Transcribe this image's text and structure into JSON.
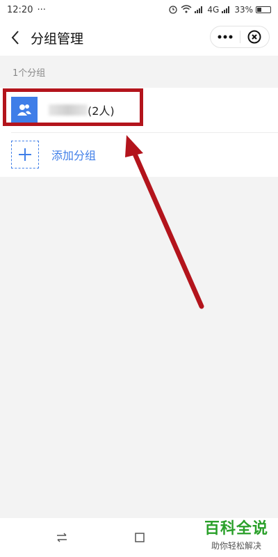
{
  "status_bar": {
    "time": "12:20",
    "overflow": "···",
    "network": "4G",
    "battery": "33%"
  },
  "header": {
    "title": "分组管理",
    "more_icon": "more-dots-icon",
    "close_icon": "close-circle-icon"
  },
  "groups_section": {
    "count_label": "1个分组"
  },
  "group_item": {
    "member_count": "(2人)",
    "icon": "group-people-icon"
  },
  "add_group": {
    "label": "添加分组",
    "icon": "plus-icon"
  },
  "watermark": {
    "title": "百科全说",
    "subtitle": "助你轻松解决"
  },
  "colors": {
    "accent": "#3f7ee8",
    "annotation": "#b3141c",
    "watermark": "#2aa02a"
  }
}
